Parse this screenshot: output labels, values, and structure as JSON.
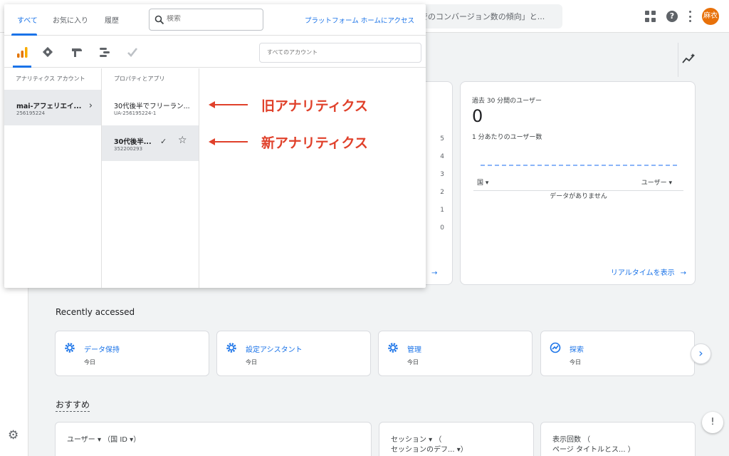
{
  "topbar": {
    "search_text": "でのコンバージョン数の傾向」と...",
    "avatar_text": "麻衣",
    "icons": [
      "apps-icon",
      "help-icon",
      "more-vert-icon"
    ]
  },
  "picker": {
    "tabs": [
      {
        "label": "すべて",
        "active": true
      },
      {
        "label": "お気に入り",
        "active": false
      },
      {
        "label": "履歴",
        "active": false
      }
    ],
    "search_placeholder": "検索",
    "platform_link": "プラットフォーム ホームにアクセス",
    "products": [
      "analytics-icon",
      "tag-manager-icon",
      "optimize-icon",
      "data-studio-icon",
      "surveys-icon"
    ],
    "account_search_placeholder": "すべてのアカウント",
    "accounts_header": "アナリティクス アカウント",
    "properties_header": "プロパティとアプリ",
    "accounts": [
      {
        "name": "mai-アフェリエイ...",
        "id": "256195224"
      }
    ],
    "properties": [
      {
        "name": "30代後半でフリーラン...",
        "id": "UA-256195224-1"
      },
      {
        "name": "30代後半...",
        "id": "352200293"
      }
    ]
  },
  "annotations": {
    "old": "旧アナリティクス",
    "new": "新アナリティクス"
  },
  "left_card": {
    "y_ticks": [
      "5",
      "4",
      "3",
      "2",
      "1",
      "0"
    ],
    "link": "示"
  },
  "realtime": {
    "title": "過去 30 分間のユーザー",
    "value": "0",
    "subtitle": "1 分あたりのユーザー数",
    "col_country": "国 ▾",
    "col_users": "ユーザー ▾",
    "empty": "データがありません",
    "link": "リアルタイムを表示"
  },
  "recent": {
    "title": "Recently accessed",
    "items": [
      {
        "label": "データ保持",
        "sub": "今日",
        "icon": "gear-icon"
      },
      {
        "label": "設定アシスタント",
        "sub": "今日",
        "icon": "gear-icon"
      },
      {
        "label": "管理",
        "sub": "今日",
        "icon": "gear-icon"
      },
      {
        "label": "探索",
        "sub": "今日",
        "icon": "explore-icon"
      }
    ]
  },
  "recommended": {
    "title": "おすすめ",
    "cards": [
      {
        "line1": "ユーザー ▾ （国 ID ▾）",
        "line2": ""
      },
      {
        "line1": "セッション ▾ （",
        "line2": "セッションのデフ... ▾）"
      },
      {
        "line1": "表示回数 （",
        "line2": "ページ タイトルとス... ）"
      }
    ]
  },
  "colors": {
    "accent": "#1a73e8",
    "annotation": "#e0402a",
    "avatar": "#e8710a"
  }
}
